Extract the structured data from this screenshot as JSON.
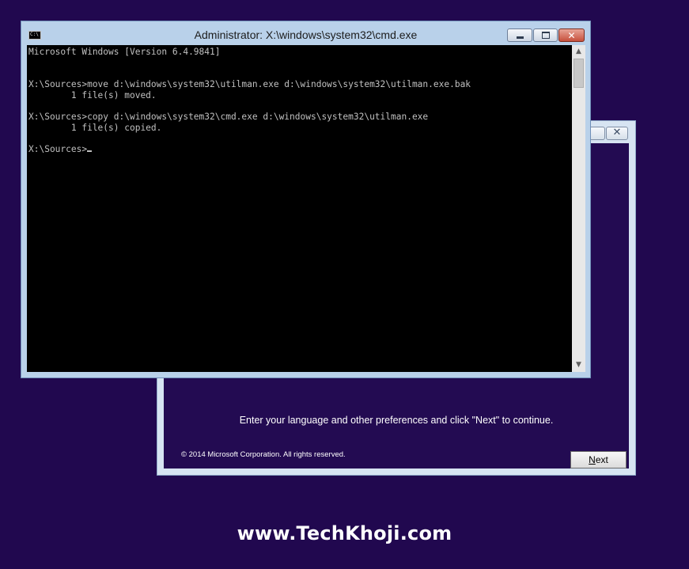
{
  "setup": {
    "instruction": "Enter your language and other preferences and click \"Next\" to continue.",
    "copyright": "© 2014 Microsoft Corporation. All rights reserved.",
    "next_accel": "N",
    "next_rest": "ext"
  },
  "cmd": {
    "title": "Administrator: X:\\windows\\system32\\cmd.exe",
    "icon_text": "C:\\",
    "lines": [
      "Microsoft Windows [Version 6.4.9841]",
      "",
      "",
      "X:\\Sources>move d:\\windows\\system32\\utilman.exe d:\\windows\\system32\\utilman.exe.bak",
      "        1 file(s) moved.",
      "",
      "X:\\Sources>copy d:\\windows\\system32\\cmd.exe d:\\windows\\system32\\utilman.exe",
      "        1 file(s) copied.",
      "",
      "X:\\Sources>"
    ]
  },
  "watermark": "www.TechKhoji.com",
  "colors": {
    "desktop": "#21084f",
    "console_bg": "#000000",
    "console_text": "#c0c0c0",
    "close_button": "#c7503c"
  },
  "icons": {
    "cmd": "cmd-window-icon",
    "minimize": "minimize-icon",
    "maximize": "maximize-icon",
    "close": "close-icon",
    "scroll_up": "chevron-up-icon",
    "scroll_down": "chevron-down-icon"
  }
}
